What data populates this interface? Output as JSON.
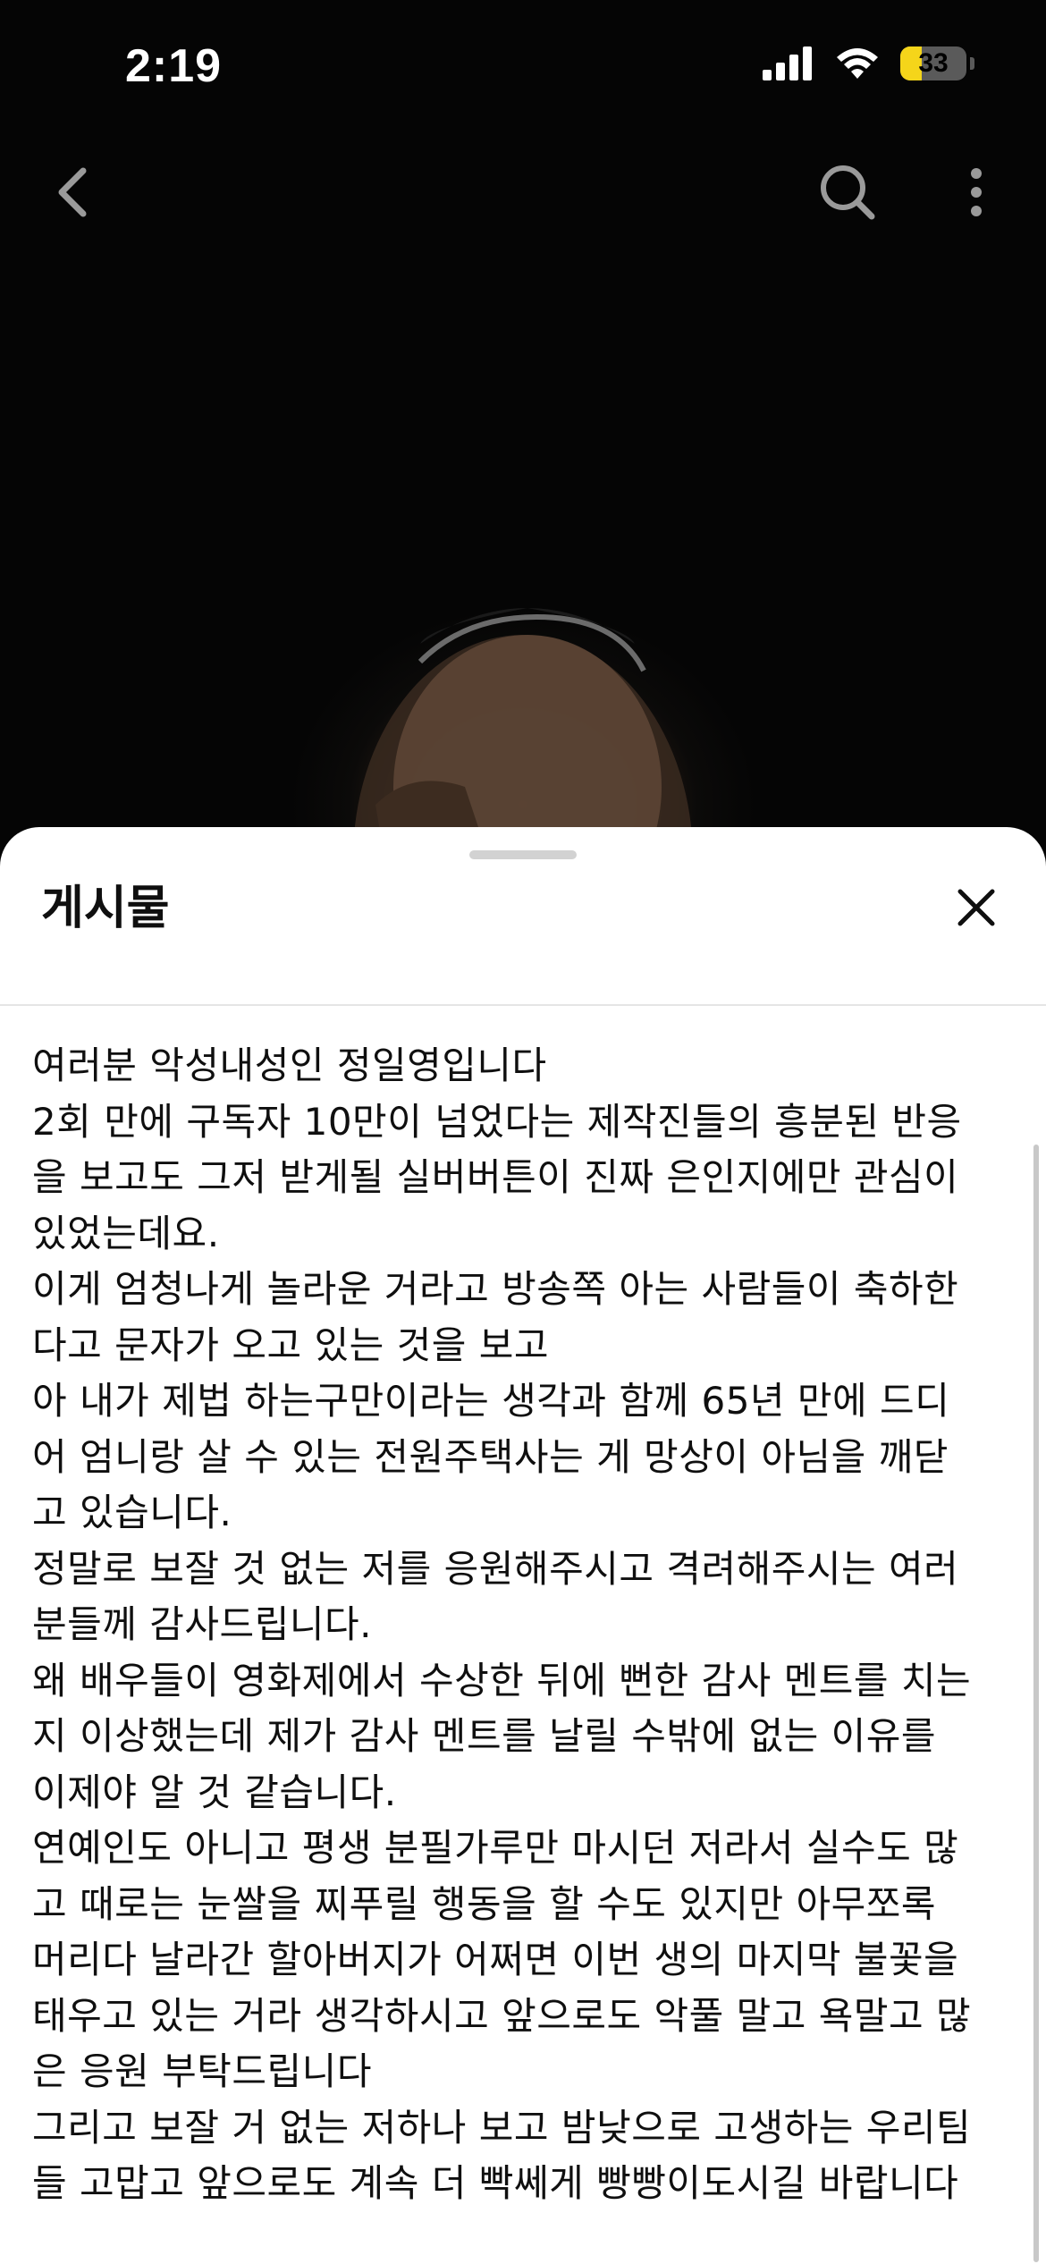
{
  "status_bar": {
    "time": "2:19",
    "battery_percent": "33",
    "battery_level": 0.33,
    "icons": [
      "cellular-signal-icon",
      "wifi-icon",
      "battery-icon"
    ],
    "battery_color": "#f5d51a"
  },
  "top_nav": {
    "icons": [
      "back-arrow-icon",
      "search-icon",
      "more-vertical-icon"
    ]
  },
  "sheet": {
    "title": "게시물",
    "close_icon": "close-icon",
    "post_lines": [
      "여러분 악성내성인 정일영입니다",
      "2회 만에 구독자 10만이 넘었다는 제작진들의 흥분된 반응",
      "을 보고도 그저 받게될 실버버튼이 진짜 은인지에만 관심이",
      "있었는데요.",
      "이게 엄청나게 놀라운 거라고 방송쪽 아는 사람들이 축하한",
      "다고 문자가 오고 있는 것을 보고",
      "아 내가 제법 하는구만이라는 생각과 함께 65년 만에 드디",
      "어 엄니랑 살 수 있는 전원주택사는 게  망상이 아님을 깨닫",
      "고 있습니다.",
      "정말로 보잘 것 없는 저를 응원해주시고 격려해주시는 여러",
      "분들께 감사드립니다.",
      "왜 배우들이 영화제에서 수상한 뒤에 뻔한 감사 멘트를 치는",
      "지 이상했는데 제가 감사 멘트를 날릴 수밖에 없는 이유를",
      "이제야 알 것 같습니다.",
      "연예인도 아니고 평생 분필가루만 마시던 저라서 실수도 많",
      "고 때로는 눈쌀을 찌푸릴 행동을 할 수도 있지만 아무쪼록",
      "머리다 날라간 할아버지가 어쩌면 이번 생의 마지막 불꽃을",
      "태우고 있는 거라 생각하시고 앞으로도 악풀 말고 욕말고 많",
      "은 응원 부탁드립니다",
      "그리고 보잘 거 없는 저하나 보고 밤낮으로 고생하는 우리팀",
      "들 고맙고 앞으로도 계속 더 빡쎄게 빵빵이도시길 바랍니다"
    ]
  }
}
